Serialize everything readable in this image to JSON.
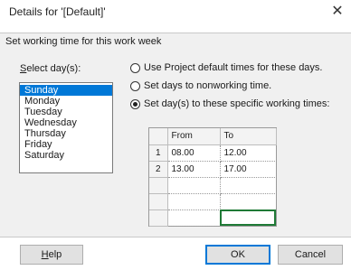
{
  "dialog": {
    "title": "Details for '[Default]'",
    "section_heading": "Set working time for this work week"
  },
  "days": {
    "label": "Select day(s):",
    "items": [
      "Sunday",
      "Monday",
      "Tuesday",
      "Wednesday",
      "Thursday",
      "Friday",
      "Saturday"
    ],
    "selected": "Sunday"
  },
  "options": [
    {
      "label": "Use Project default times for these days.",
      "checked": false
    },
    {
      "label": "Set days to nonworking time.",
      "checked": false
    },
    {
      "label": "Set day(s) to these specific working times:",
      "checked": true
    }
  ],
  "grid": {
    "headers": [
      "From",
      "To"
    ],
    "rows": [
      {
        "num": "1",
        "from": "08.00",
        "to": "12.00"
      },
      {
        "num": "2",
        "from": "13.00",
        "to": "17.00"
      },
      {
        "num": "",
        "from": "",
        "to": ""
      },
      {
        "num": "",
        "from": "",
        "to": ""
      },
      {
        "num": "",
        "from": "",
        "to": ""
      }
    ]
  },
  "buttons": {
    "help": "Help",
    "ok": "OK",
    "cancel": "Cancel"
  }
}
